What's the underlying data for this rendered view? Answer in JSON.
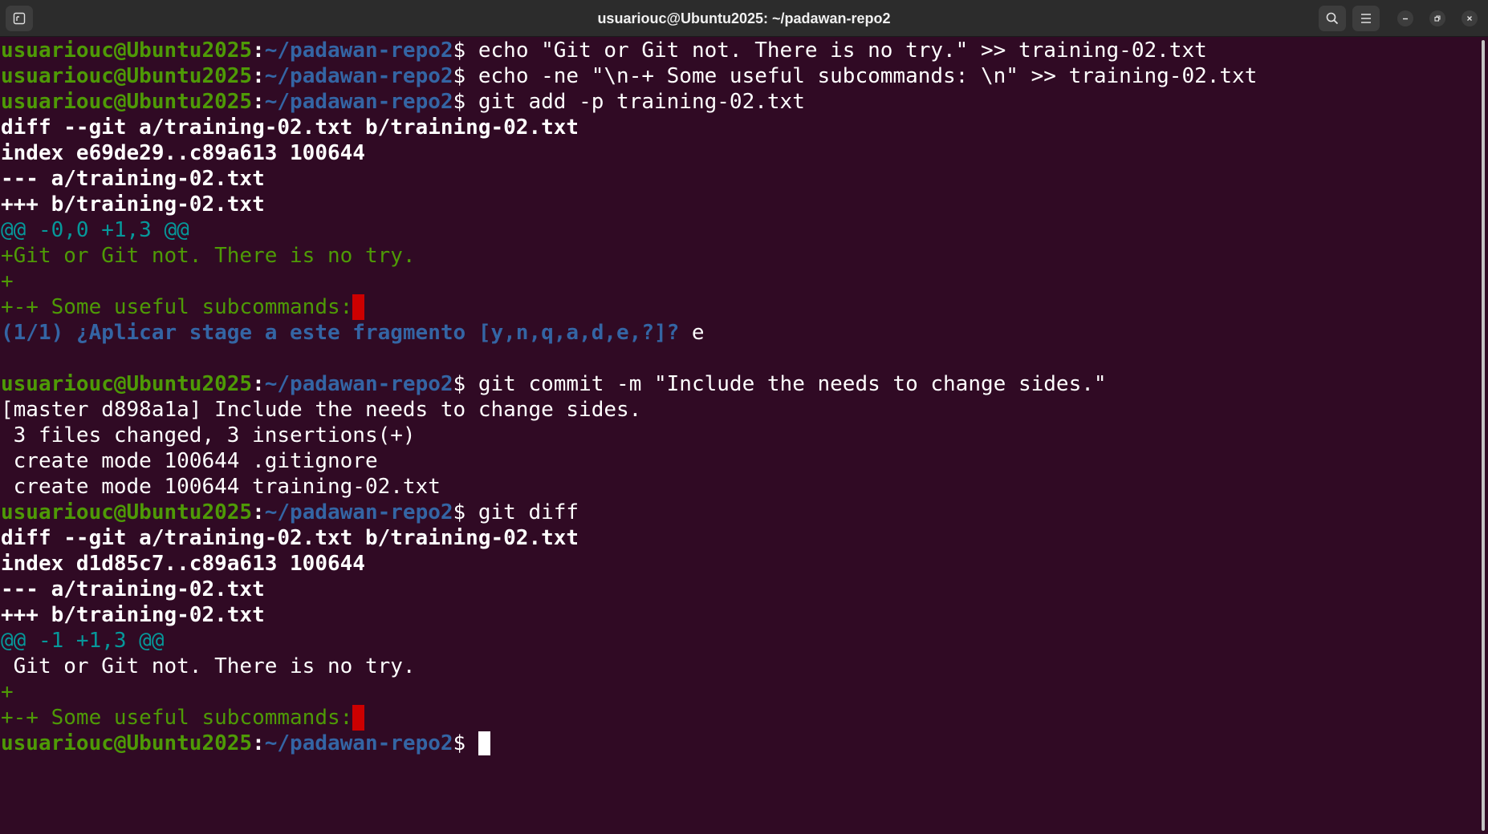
{
  "window": {
    "title": "usuariouc@Ubuntu2025: ~/padawan-repo2",
    "icons": {
      "new_tab": "terminal-tab-icon",
      "search": "search-icon",
      "menu": "hamburger-menu-icon",
      "minimize": "minimize-icon",
      "maximize": "restore-icon",
      "close": "close-icon"
    }
  },
  "prompt": {
    "user": "usuariouc@Ubuntu2025",
    "colon": ":",
    "path": "~/padawan-repo2",
    "dollar": "$"
  },
  "lines": {
    "l1_cmd": " echo \"Git or Git not. There is no try.\" >> training-02.txt",
    "l2_cmd": " echo -ne \"\\n-+ Some useful subcommands: \\n\" >> training-02.txt",
    "l3_cmd": " git add -p training-02.txt",
    "l4": "diff --git a/training-02.txt b/training-02.txt",
    "l5": "index e69de29..c89a613 100644",
    "l6": "--- a/training-02.txt",
    "l7": "+++ b/training-02.txt",
    "l8": "@@ -0,0 +1,3 @@",
    "l9": "+Git or Git not. There is no try.",
    "l10": "+",
    "l11": "+-+ Some useful subcommands:",
    "l12_question": "(1/1) ¿Aplicar stage a este fragmento [y,n,q,a,d,e,?]?",
    "l12_answer": " e",
    "l14_cmd": " git commit -m \"Include the needs to change sides.\"",
    "l15": "[master d898a1a] Include the needs to change sides.",
    "l16": " 3 files changed, 3 insertions(+)",
    "l17": " create mode 100644 .gitignore",
    "l18": " create mode 100644 training-02.txt",
    "l19_cmd": " git diff",
    "l20": "diff --git a/training-02.txt b/training-02.txt",
    "l21": "index d1d85c7..c89a613 100644",
    "l22": "--- a/training-02.txt",
    "l23": "+++ b/training-02.txt",
    "l24": "@@ -1 +1,3 @@",
    "l25": " Git or Git not. There is no try.",
    "l26": "+",
    "l27": "+-+ Some useful subcommands:",
    "l28_cmd": " "
  },
  "colors": {
    "background": "#300a24",
    "prompt_user": "#4e9a06",
    "prompt_path": "#3465a4",
    "diff_added": "#4e9a06",
    "diff_hunk": "#06989a",
    "trailing_whitespace": "#cc0000"
  }
}
